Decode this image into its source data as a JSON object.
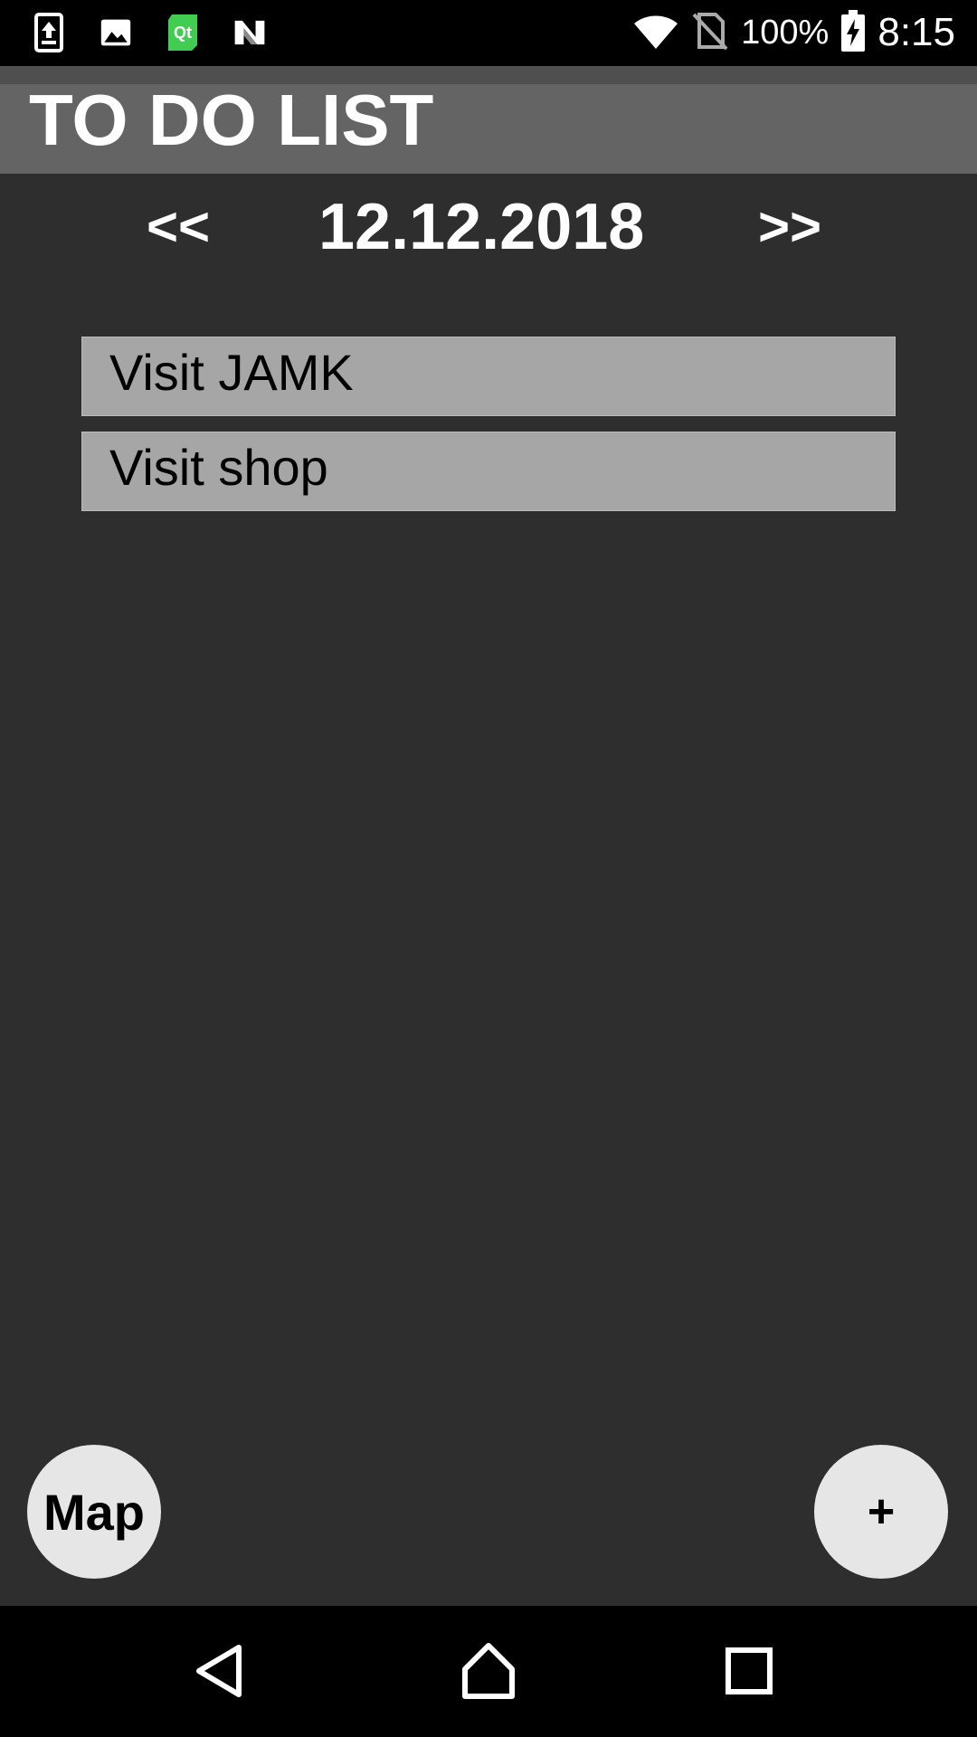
{
  "status_bar": {
    "battery_percent": "100%",
    "time": "8:15",
    "icons": [
      "upload-icon",
      "image-icon",
      "qt-icon",
      "n-icon",
      "wifi-icon",
      "no-sim-icon",
      "battery-charging-icon"
    ]
  },
  "header": {
    "title": "TO DO LIST"
  },
  "date_nav": {
    "prev_label": "<<",
    "date": "12.12.2018",
    "next_label": ">>"
  },
  "tasks": [
    {
      "label": "Visit JAMK"
    },
    {
      "label": "Visit shop"
    }
  ],
  "buttons": {
    "map_label": "Map",
    "add_label": "+"
  },
  "nav_bar": {
    "icons": [
      "back-icon",
      "home-icon",
      "recents-icon"
    ]
  },
  "colors": {
    "background": "#2e2e2e",
    "header": "#646464",
    "task_item": "#a6a6a6",
    "fab": "#e6e6e6",
    "qt_green": "#41cd52"
  }
}
